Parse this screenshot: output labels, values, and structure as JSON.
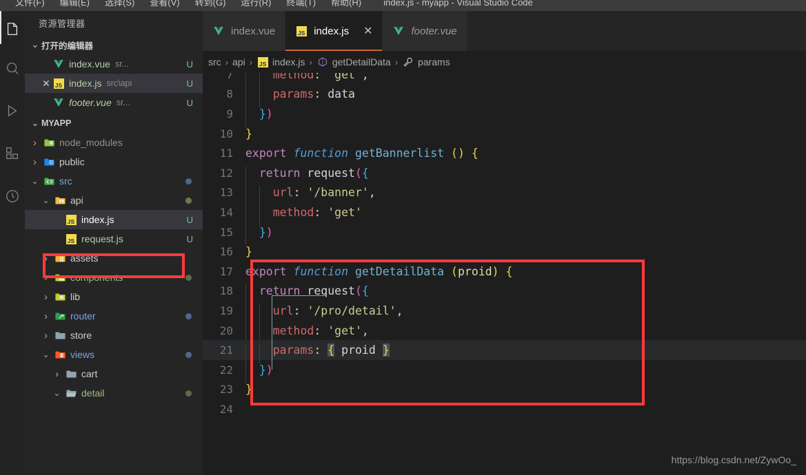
{
  "titlebar": {
    "menu": [
      {
        "label": "文件(F)"
      },
      {
        "label": "编辑(E)"
      },
      {
        "label": "选择(S)"
      },
      {
        "label": "查看(V)"
      },
      {
        "label": "转到(G)"
      },
      {
        "label": "运行(R)"
      },
      {
        "label": "终端(T)"
      },
      {
        "label": "帮助(H)"
      }
    ],
    "window_title": "index.js - myapp - Visual Studio Code"
  },
  "activity_bar": {
    "items": [
      {
        "name": "explorer-icon",
        "active": true
      },
      {
        "name": "search-icon",
        "active": false
      },
      {
        "name": "run-debug-icon",
        "active": false
      },
      {
        "name": "extensions-icon",
        "active": false
      },
      {
        "name": "timeline-icon",
        "active": false
      }
    ]
  },
  "sidebar": {
    "title": "资源管理器",
    "open_editors": {
      "header": "打开的编辑器",
      "items": [
        {
          "name": "index.vue",
          "path": "sr...",
          "status": "U",
          "icon": "vue-icon",
          "selected": false,
          "dirty": false,
          "italic": false
        },
        {
          "name": "index.js",
          "path": "src\\api",
          "status": "U",
          "icon": "js-icon",
          "selected": true,
          "dirty": false,
          "italic": false
        },
        {
          "name": "footer.vue",
          "path": "sr...",
          "status": "U",
          "icon": "vue-icon",
          "selected": false,
          "dirty": false,
          "italic": true
        }
      ]
    },
    "project": {
      "header": "MYAPP",
      "tree": [
        {
          "label": "node_modules",
          "type": "folder",
          "icon": "folder-node-icon",
          "depth": 1,
          "twisty": "closed",
          "badge": "",
          "dot": ""
        },
        {
          "label": "public",
          "type": "folder",
          "icon": "folder-public-icon",
          "depth": 1,
          "twisty": "closed",
          "badge": "",
          "dot": ""
        },
        {
          "label": "src",
          "type": "folder",
          "icon": "folder-src-icon",
          "depth": 1,
          "twisty": "open",
          "badge": "",
          "dot": "#4b6a8a"
        },
        {
          "label": "api",
          "type": "folder",
          "icon": "folder-api-icon",
          "depth": 2,
          "twisty": "open",
          "badge": "",
          "dot": "#6b7a4b"
        },
        {
          "label": "index.js",
          "type": "file",
          "icon": "js-icon",
          "depth": 3,
          "twisty": "none",
          "badge": "U",
          "dot": "",
          "selected": true,
          "highlighted": true
        },
        {
          "label": "request.js",
          "type": "file",
          "icon": "js-icon",
          "depth": 3,
          "twisty": "none",
          "badge": "U",
          "dot": ""
        },
        {
          "label": "assets",
          "type": "folder",
          "icon": "folder-assets-icon",
          "depth": 2,
          "twisty": "closed",
          "badge": "",
          "dot": ""
        },
        {
          "label": "components",
          "type": "folder",
          "icon": "folder-components-icon",
          "depth": 2,
          "twisty": "closed",
          "badge": "",
          "dot": "#5c6b4b"
        },
        {
          "label": "lib",
          "type": "folder",
          "icon": "folder-lib-icon",
          "depth": 2,
          "twisty": "closed",
          "badge": "",
          "dot": ""
        },
        {
          "label": "router",
          "type": "folder",
          "icon": "folder-router-icon",
          "depth": 2,
          "twisty": "closed",
          "badge": "",
          "dot": "#4b6a8a"
        },
        {
          "label": "store",
          "type": "folder",
          "icon": "folder-plain-icon",
          "depth": 2,
          "twisty": "closed",
          "badge": "",
          "dot": ""
        },
        {
          "label": "views",
          "type": "folder",
          "icon": "folder-views-icon",
          "depth": 2,
          "twisty": "open",
          "badge": "",
          "dot": "#4b6a8a"
        },
        {
          "label": "cart",
          "type": "folder",
          "icon": "folder-plain-icon",
          "depth": 3,
          "twisty": "closed",
          "badge": "",
          "dot": ""
        },
        {
          "label": "detail",
          "type": "folder",
          "icon": "folder-open-plain-icon",
          "depth": 3,
          "twisty": "open",
          "badge": "",
          "dot": "#5c6b4b"
        }
      ]
    }
  },
  "tabs": [
    {
      "label": "index.vue",
      "icon": "vue-icon",
      "active": false,
      "italic": false,
      "closable": false
    },
    {
      "label": "index.js",
      "icon": "js-icon",
      "active": true,
      "italic": false,
      "closable": true
    },
    {
      "label": "footer.vue",
      "icon": "vue-icon",
      "active": false,
      "italic": true,
      "closable": false
    }
  ],
  "breadcrumb": [
    {
      "label": "src",
      "icon": ""
    },
    {
      "label": "api",
      "icon": ""
    },
    {
      "label": "index.js",
      "icon": "js-icon"
    },
    {
      "label": "getDetailData",
      "icon": "symbol-method-icon"
    },
    {
      "label": "params",
      "icon": "symbol-property-icon"
    }
  ],
  "editor": {
    "first_visible_line": 7,
    "highlighted_line": 21,
    "lines": [
      {
        "n": 7,
        "partial": true,
        "tokens": [
          {
            "t": "    ",
            "c": "t-plain"
          },
          {
            "t": "method",
            "c": "t-prop"
          },
          {
            "t": ": ",
            "c": "t-plain"
          },
          {
            "t": "'get'",
            "c": "t-str"
          },
          {
            "t": ",",
            "c": "t-plain"
          }
        ]
      },
      {
        "n": 8,
        "tokens": [
          {
            "t": "    ",
            "c": "t-plain"
          },
          {
            "t": "params",
            "c": "t-prop"
          },
          {
            "t": ": ",
            "c": "t-plain"
          },
          {
            "t": "data",
            "c": "t-var"
          }
        ]
      },
      {
        "n": 9,
        "tokens": [
          {
            "t": "  ",
            "c": "t-plain"
          },
          {
            "t": "}",
            "c": "t-blue"
          },
          {
            "t": ")",
            "c": "t-pink"
          }
        ]
      },
      {
        "n": 10,
        "tokens": [
          {
            "t": "}",
            "c": "t-y"
          }
        ]
      },
      {
        "n": 11,
        "tokens": [
          {
            "t": "export ",
            "c": "t-kw"
          },
          {
            "t": "function",
            "c": "t-fn-kw"
          },
          {
            "t": " ",
            "c": "t-plain"
          },
          {
            "t": "getBannerlist",
            "c": "t-fname"
          },
          {
            "t": " ",
            "c": "t-plain"
          },
          {
            "t": "(",
            "c": "t-y"
          },
          {
            "t": ")",
            "c": "t-y"
          },
          {
            "t": " ",
            "c": "t-plain"
          },
          {
            "t": "{",
            "c": "t-y"
          }
        ]
      },
      {
        "n": 12,
        "tokens": [
          {
            "t": "  ",
            "c": "t-plain"
          },
          {
            "t": "return",
            "c": "t-kw"
          },
          {
            "t": " ",
            "c": "t-plain"
          },
          {
            "t": "request",
            "c": "t-var"
          },
          {
            "t": "(",
            "c": "t-pink"
          },
          {
            "t": "{",
            "c": "t-blue"
          }
        ]
      },
      {
        "n": 13,
        "tokens": [
          {
            "t": "    ",
            "c": "t-plain"
          },
          {
            "t": "url",
            "c": "t-prop"
          },
          {
            "t": ": ",
            "c": "t-plain"
          },
          {
            "t": "'/banner'",
            "c": "t-str"
          },
          {
            "t": ",",
            "c": "t-plain"
          }
        ]
      },
      {
        "n": 14,
        "tokens": [
          {
            "t": "    ",
            "c": "t-plain"
          },
          {
            "t": "method",
            "c": "t-prop"
          },
          {
            "t": ": ",
            "c": "t-plain"
          },
          {
            "t": "'get'",
            "c": "t-str"
          }
        ]
      },
      {
        "n": 15,
        "tokens": [
          {
            "t": "  ",
            "c": "t-plain"
          },
          {
            "t": "}",
            "c": "t-blue"
          },
          {
            "t": ")",
            "c": "t-pink"
          }
        ]
      },
      {
        "n": 16,
        "tokens": [
          {
            "t": "}",
            "c": "t-y"
          }
        ]
      },
      {
        "n": 17,
        "tokens": [
          {
            "t": "export ",
            "c": "t-kw"
          },
          {
            "t": "function",
            "c": "t-fn-kw"
          },
          {
            "t": " ",
            "c": "t-plain"
          },
          {
            "t": "getDetailData",
            "c": "t-fname"
          },
          {
            "t": " ",
            "c": "t-plain"
          },
          {
            "t": "(",
            "c": "t-y"
          },
          {
            "t": "proid",
            "c": "t-param"
          },
          {
            "t": ")",
            "c": "t-y"
          },
          {
            "t": " ",
            "c": "t-plain"
          },
          {
            "t": "{",
            "c": "t-y"
          }
        ]
      },
      {
        "n": 18,
        "tokens": [
          {
            "t": "  ",
            "c": "t-plain"
          },
          {
            "t": "return",
            "c": "t-kw"
          },
          {
            "t": " ",
            "c": "t-plain"
          },
          {
            "t": "request",
            "c": "t-var"
          },
          {
            "t": "(",
            "c": "t-pink"
          },
          {
            "t": "{",
            "c": "t-blue"
          }
        ]
      },
      {
        "n": 19,
        "tokens": [
          {
            "t": "    ",
            "c": "t-plain"
          },
          {
            "t": "url",
            "c": "t-prop"
          },
          {
            "t": ": ",
            "c": "t-plain"
          },
          {
            "t": "'/pro/detail'",
            "c": "t-str"
          },
          {
            "t": ",",
            "c": "t-plain"
          }
        ]
      },
      {
        "n": 20,
        "tokens": [
          {
            "t": "    ",
            "c": "t-plain"
          },
          {
            "t": "method",
            "c": "t-prop"
          },
          {
            "t": ": ",
            "c": "t-plain"
          },
          {
            "t": "'get'",
            "c": "t-str"
          },
          {
            "t": ",",
            "c": "t-plain"
          }
        ]
      },
      {
        "n": 21,
        "highlight": true,
        "tokens": [
          {
            "t": "    ",
            "c": "t-plain"
          },
          {
            "t": "params",
            "c": "t-prop"
          },
          {
            "t": ": ",
            "c": "t-plain"
          },
          {
            "t": "{",
            "c": "t-brace-hl"
          },
          {
            "t": " ",
            "c": "t-plain"
          },
          {
            "t": "proid",
            "c": "t-var"
          },
          {
            "t": " ",
            "c": "t-plain"
          },
          {
            "t": "}",
            "c": "t-brace-hl"
          }
        ]
      },
      {
        "n": 22,
        "tokens": [
          {
            "t": "  ",
            "c": "t-plain"
          },
          {
            "t": "}",
            "c": "t-blue"
          },
          {
            "t": ")",
            "c": "t-pink"
          }
        ]
      },
      {
        "n": 23,
        "tokens": [
          {
            "t": "}",
            "c": "t-y"
          }
        ]
      },
      {
        "n": 24,
        "tokens": []
      }
    ]
  },
  "annotations": {
    "sidebar_box": {
      "color": "#ff3b3b"
    },
    "code_box": {
      "color": "#ff3b3b"
    }
  },
  "watermark": "https://blog.csdn.net/ZywOo_"
}
